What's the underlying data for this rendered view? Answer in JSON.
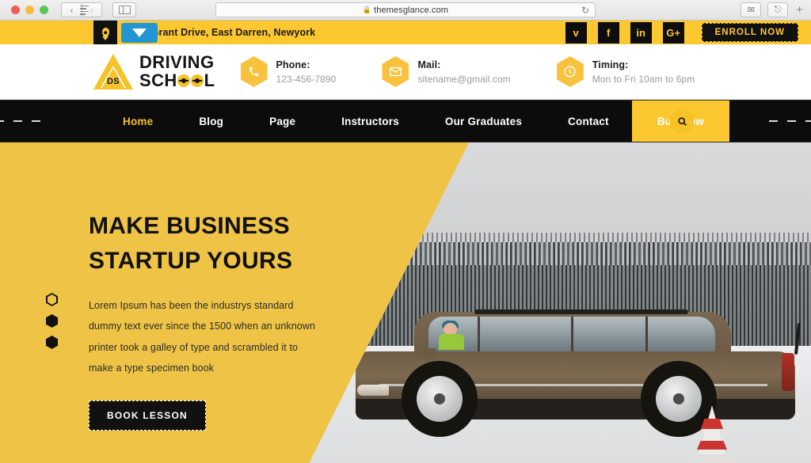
{
  "browser": {
    "url": "themesglance.com",
    "lock_icon": "lock-icon",
    "reload_icon": "reload-icon",
    "back_label": "‹",
    "forward_label": "›",
    "share_icon": "share-icon",
    "tabs_icon": "tabs-icon",
    "new_tab_label": "+"
  },
  "topbar": {
    "address": "53 Grant Drive, East Darren, Newyork",
    "location_icon": "map-pin-icon",
    "translate_icon": "translate-dropdown-icon",
    "socials": [
      {
        "name": "twitter",
        "glyph": "ᴠ"
      },
      {
        "name": "facebook",
        "glyph": "f"
      },
      {
        "name": "linkedin",
        "glyph": "in"
      },
      {
        "name": "googleplus",
        "glyph": "G+"
      }
    ],
    "enroll_label": "ENROLL NOW"
  },
  "header": {
    "logo": {
      "badge": "DS",
      "line1": "DRIVING",
      "line2_pre": "SCH",
      "line2_post": "L"
    },
    "contacts": [
      {
        "icon": "phone-icon",
        "label": "Phone:",
        "value": "123-456-7890"
      },
      {
        "icon": "mail-icon",
        "label": "Mail:",
        "value": "sitename@gmail.com"
      },
      {
        "icon": "clock-icon",
        "label": "Timing:",
        "value": "Mon to Fri 10am to 6pm"
      }
    ]
  },
  "nav": {
    "items": [
      {
        "label": "Home",
        "state": "active"
      },
      {
        "label": "Blog",
        "state": "normal"
      },
      {
        "label": "Page",
        "state": "normal"
      },
      {
        "label": "Instructors",
        "state": "normal"
      },
      {
        "label": "Our Graduates",
        "state": "normal"
      },
      {
        "label": "Contact",
        "state": "normal"
      },
      {
        "label": "Buy Now",
        "state": "highlight"
      }
    ],
    "search_icon": "search-icon"
  },
  "hero": {
    "title_line1": "MAKE BUSINESS",
    "title_line2": "STARTUP YOURS",
    "description": "Lorem Ipsum has been the industrys standard dummy text ever since the 1500 when an unknown printer took a galley of type and scrambled it to make a type specimen book",
    "button_label": "BOOK LESSON",
    "slider_dots": [
      "hollow",
      "filled",
      "filled"
    ],
    "image_alt": "brown-suv-on-snow-road"
  },
  "colors": {
    "topbar_yellow": "#FDC82F",
    "hero_yellow": "#EFC446",
    "accent_yellow": "#F5C227",
    "nav_black": "#0C0C0C",
    "text_dark": "#111111",
    "muted_grey": "#9A9A9A",
    "translate_blue": "#2196D3"
  }
}
